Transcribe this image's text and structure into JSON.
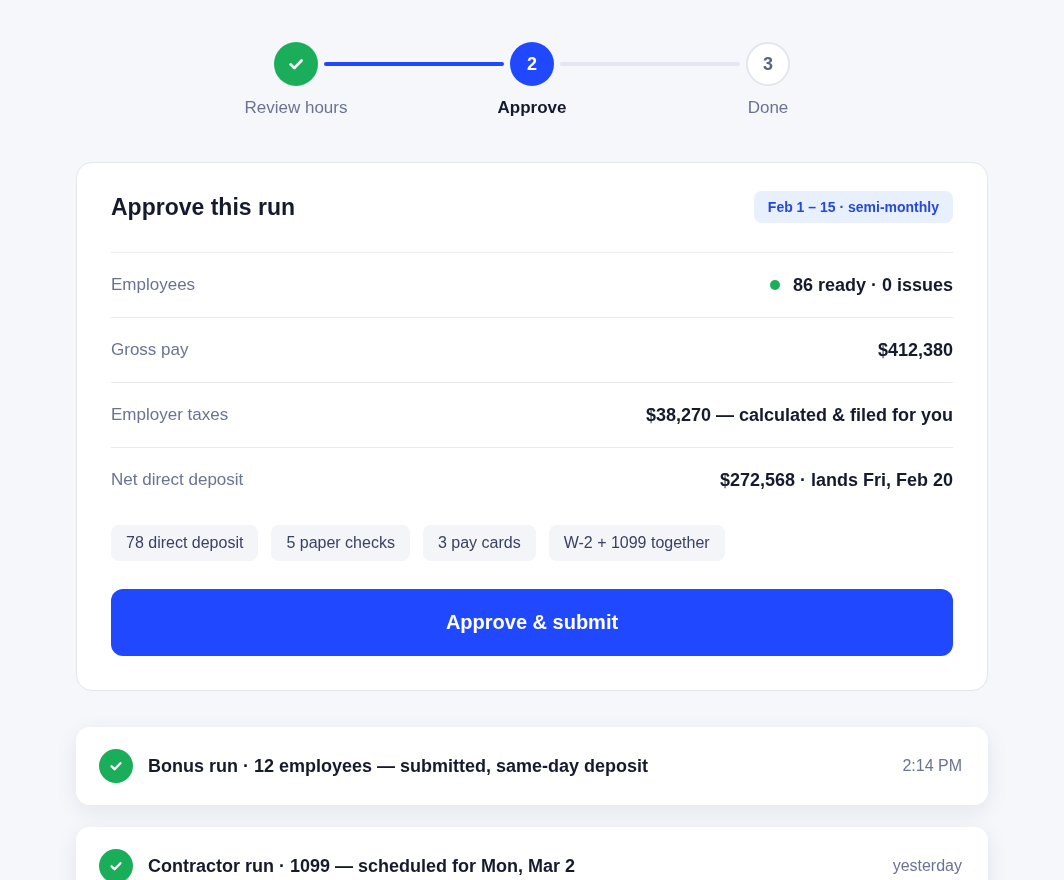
{
  "stepper": {
    "steps": [
      {
        "label": "Review hours",
        "completed": true,
        "selected": false
      },
      {
        "number": "2",
        "label": "Approve",
        "completed": false,
        "selected": true
      },
      {
        "number": "3",
        "label": "Done",
        "completed": false,
        "selected": false
      }
    ]
  },
  "approval_card": {
    "title": "Approve this run",
    "period_badge": "Feb 1 – 15 · semi-monthly",
    "rows": [
      {
        "label": "Employees",
        "value": "86 ready · 0 issues",
        "kind": "status"
      },
      {
        "label": "Gross pay",
        "value": "$412,380",
        "kind": "plain"
      },
      {
        "label": "Employer taxes",
        "value": "$38,270 — calculated & filed for you",
        "kind": "plain"
      },
      {
        "label": "Net direct deposit",
        "value": "$272,568 · lands Fri, Feb 20",
        "kind": "plain"
      }
    ],
    "chips": [
      "78 direct deposit",
      "5 paper checks",
      "3 pay cards",
      "W-2 + 1099 together"
    ],
    "primary_button": "Approve & submit"
  },
  "activity": [
    {
      "text": "Bonus run · 12 employees — submitted, same-day deposit",
      "time": "2:14 PM",
      "completed": true
    },
    {
      "text": "Contractor run · 1099 — scheduled for Mon, Mar 2",
      "time": "yesterday",
      "completed": true
    }
  ]
}
